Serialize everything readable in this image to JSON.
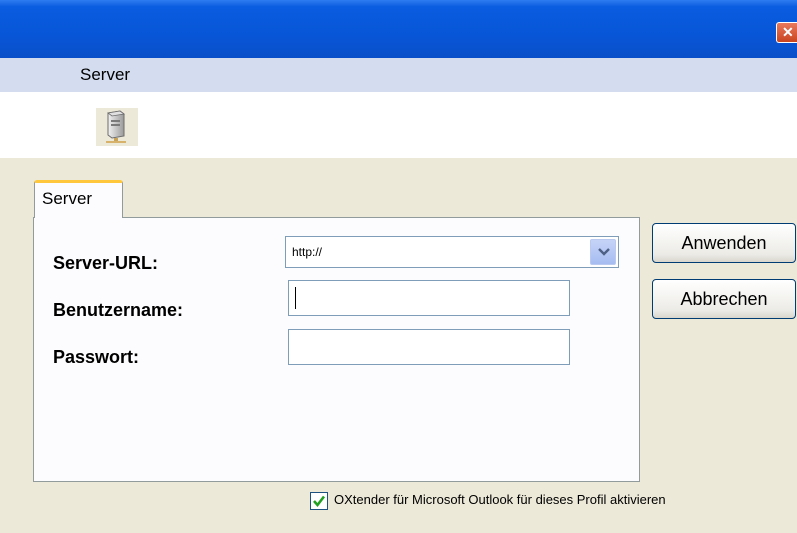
{
  "header": {
    "section_label": "Server"
  },
  "icons": {
    "server": "server-icon",
    "close": "close-icon",
    "dropdown": "chevron-down-icon",
    "check": "checkmark-icon"
  },
  "tab": {
    "label": "Server"
  },
  "form": {
    "server_url_label": "Server-URL:",
    "server_url_value": "http://",
    "username_label": "Benutzername:",
    "username_value": "",
    "password_label": "Passwort:",
    "password_value": ""
  },
  "buttons": {
    "apply": "Anwenden",
    "cancel": "Abbrechen"
  },
  "checkbox": {
    "label": "OXtender für Microsoft Outlook für dieses Profil aktivieren",
    "checked": true
  },
  "colors": {
    "titlebar": "#0a5ce0",
    "header_strip": "#d4dcef",
    "window_bg": "#ece9d8",
    "tab_accent": "#ffc83c",
    "checkmark": "#21a121"
  }
}
